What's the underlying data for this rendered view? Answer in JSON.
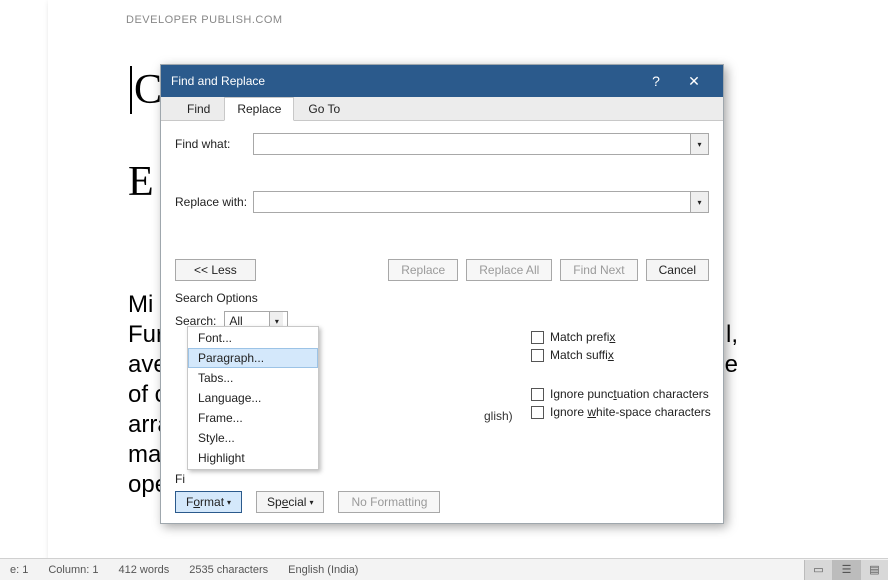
{
  "watermark": "DEVELOPER PUBLISH.COM",
  "doc": {
    "c": "C",
    "e": "E",
    "para_lines": [
      " Mi",
      "Fur",
      "ave",
      "of c",
      "arra",
      "ma",
      "ope"
    ],
    "para_right": [
      "",
      "",
      "l,",
      "e",
      "",
      "",
      ""
    ]
  },
  "statusbar": {
    "page": "e: 1",
    "col": "Column: 1",
    "words": "412 words",
    "chars": "2535 characters",
    "lang": "English (India)"
  },
  "dialog": {
    "title": "Find and Replace",
    "tabs": {
      "find": "Find",
      "replace": "Replace",
      "goto": "Go To"
    },
    "find_what": "Find what:",
    "replace_with": "Replace with:",
    "btn_less": "<<  Less",
    "btn_replace": "Replace",
    "btn_replace_all": "Replace All",
    "btn_find_next": "Find Next",
    "btn_cancel": "Cancel",
    "search_options": "Search Options",
    "search_label": "Search:",
    "search_value": "All",
    "chk_prefix": "Match prefix",
    "chk_suffix": "Match suffix",
    "chk_punct": "Ignore punctuation characters",
    "chk_white": "Ignore white-space characters",
    "lang_suffix": "glish)",
    "find_section": "Fi",
    "btn_format": "Format",
    "btn_special": "Special",
    "btn_nofmt": "No Formatting",
    "format_menu": {
      "font": "Font...",
      "paragraph": "Paragraph...",
      "tabs": "Tabs...",
      "language": "Language...",
      "frame": "Frame...",
      "style": "Style...",
      "highlight": "Highlight"
    }
  }
}
